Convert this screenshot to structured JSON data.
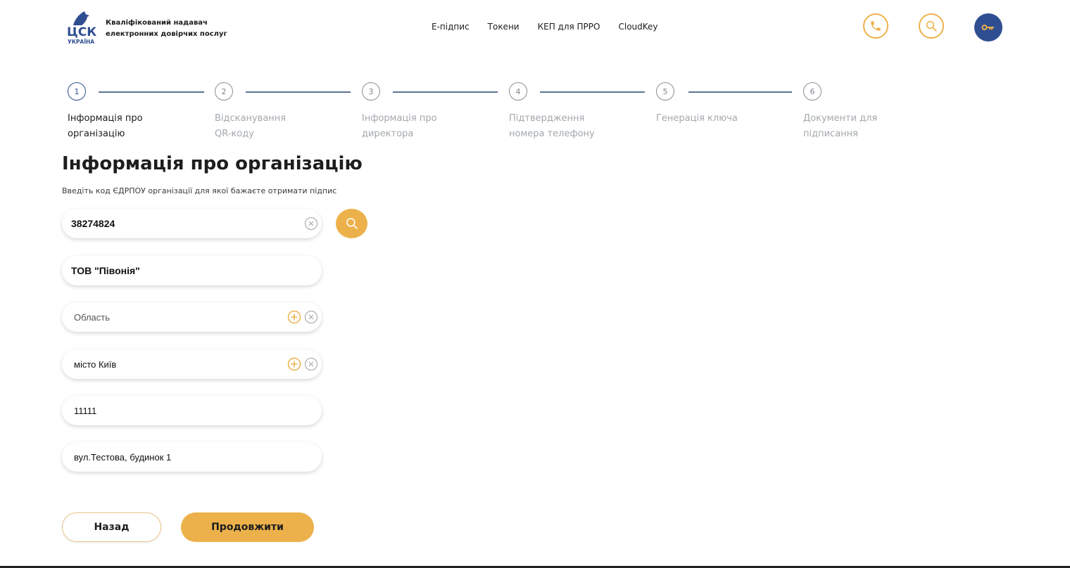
{
  "header": {
    "logo_main": "ЦСК",
    "logo_sub": "УКРАЇНА",
    "tagline_line1": "Кваліфікований надавач",
    "tagline_line2": "електронних довірчих послуг",
    "nav": [
      "Е-підпис",
      "Токени",
      "КЕП для ПРРО",
      "CloudKey"
    ]
  },
  "stepper": {
    "steps": [
      {
        "number": "1",
        "line1": "Інформація про",
        "line2": "організацію"
      },
      {
        "number": "2",
        "line1": "Відсканування",
        "line2": "QR-коду"
      },
      {
        "number": "3",
        "line1": "Інформація про",
        "line2": "директора"
      },
      {
        "number": "4",
        "line1": "Підтвердження",
        "line2": "номера телефону"
      },
      {
        "number": "5",
        "line1": "Генерація ключа",
        "line2": ""
      },
      {
        "number": "6",
        "line1": "Документи для",
        "line2": "підписання"
      }
    ],
    "active": 1
  },
  "main": {
    "title": "Інформація про організацію",
    "subtitle": "Введіть код ЄДРПОУ організації для якої бажаєте отримати підпис",
    "edrpou": "38274824",
    "org_name": "ТОВ \"Півонія\"",
    "region_placeholder": "Область",
    "city": "місто Київ",
    "postcode": "11111",
    "address": "вул.Тестова, будинок 1",
    "back_label": "Назад",
    "continue_label": "Продовжити"
  },
  "colors": {
    "accent": "#ecb14a",
    "brand_blue": "#2f4e91",
    "step_line": "#5e7391"
  },
  "icons": [
    "phone-icon",
    "search-icon",
    "key-icon",
    "clear-icon",
    "add-icon",
    "logo-bird-icon"
  ]
}
